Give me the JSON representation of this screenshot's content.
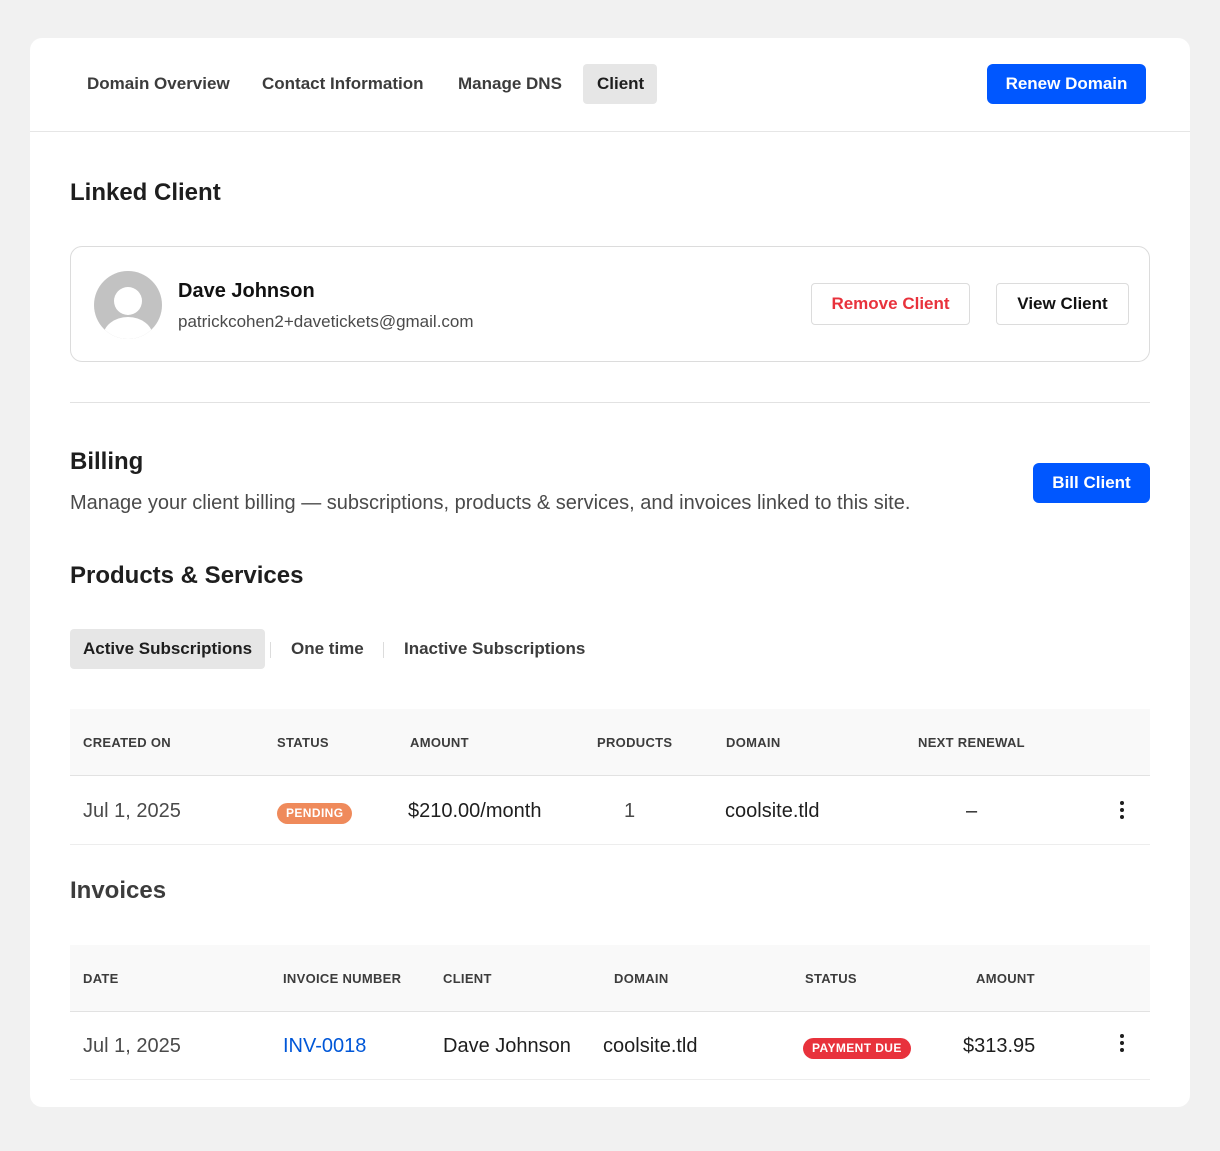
{
  "topnav": {
    "tabs": [
      "Domain Overview",
      "Contact Information",
      "Manage DNS",
      "Client"
    ],
    "active_tab": "Client",
    "renew_label": "Renew Domain"
  },
  "linked_client": {
    "title": "Linked Client",
    "name": "Dave Johnson",
    "email": "patrickcohen2+davetickets@gmail.com",
    "remove_label": "Remove Client",
    "view_label": "View Client"
  },
  "billing": {
    "title": "Billing",
    "description": "Manage your client billing — subscriptions, products & services, and invoices linked to this site.",
    "bill_label": "Bill Client"
  },
  "products": {
    "title": "Products & Services",
    "tabs": [
      "Active Subscriptions",
      "One time",
      "Inactive Subscriptions"
    ],
    "active_tab": "Active Subscriptions",
    "columns": [
      "CREATED ON",
      "STATUS",
      "AMOUNT",
      "PRODUCTS",
      "DOMAIN",
      "NEXT RENEWAL"
    ],
    "rows": [
      {
        "created_on": "Jul 1, 2025",
        "status": "PENDING",
        "amount": "$210.00/month",
        "products": "1",
        "domain": "coolsite.tld",
        "next_renewal": "–"
      }
    ]
  },
  "invoices": {
    "title": "Invoices",
    "columns": [
      "DATE",
      "INVOICE NUMBER",
      "CLIENT",
      "DOMAIN",
      "STATUS",
      "AMOUNT"
    ],
    "rows": [
      {
        "date": "Jul 1, 2025",
        "invoice_number": "INV-0018",
        "client": "Dave Johnson",
        "domain": "coolsite.tld",
        "status": "PAYMENT DUE",
        "amount": "$313.95"
      }
    ]
  },
  "colors": {
    "primary": "#0057ff",
    "danger": "#e8323c",
    "pending": "#ef8a5b",
    "payment_due": "#e8323c",
    "link": "#0057d8"
  }
}
